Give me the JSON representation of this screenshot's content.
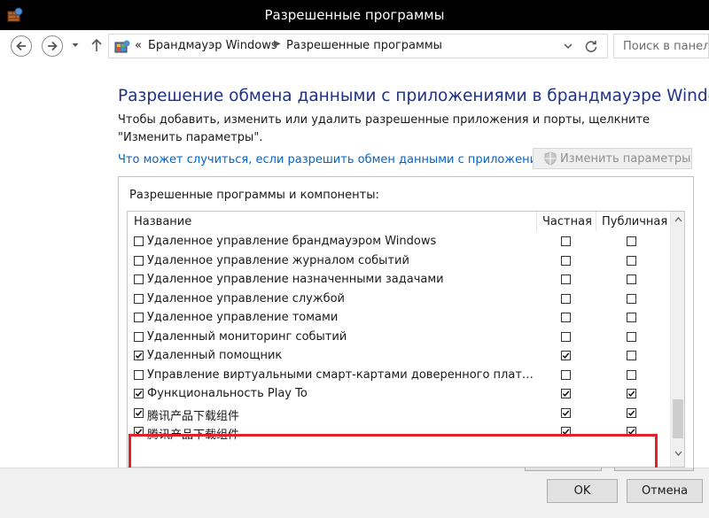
{
  "window": {
    "title": "Разрешенные программы",
    "icon": "firewall-app-icon"
  },
  "navigation": {
    "breadcrumb_prefix": "«",
    "breadcrumb": [
      "Брандмауэр Windows",
      "Разрешенные программы"
    ],
    "search_placeholder": "Поиск в панели"
  },
  "page": {
    "heading": "Разрешение обмена данными с приложениями в брандмауэре Windows",
    "description": "Чтобы добавить, изменить или удалить разрешенные приложения и порты, щелкните \"Изменить параметры\".",
    "risk_link": "Что может случиться, если разрешить обмен данными с приложением?",
    "change_settings_label": "Изменить параметры"
  },
  "panel": {
    "title": "Разрешенные программы и компоненты:",
    "columns": {
      "name": "Название",
      "private": "Частная",
      "public": "Публичная"
    },
    "rows": [
      {
        "name": "Удаленное управление брандмауэром Windows",
        "enabled": false,
        "private": false,
        "public": false
      },
      {
        "name": "Удаленное управление журналом событий",
        "enabled": false,
        "private": false,
        "public": false
      },
      {
        "name": "Удаленное управление назначенными задачами",
        "enabled": false,
        "private": false,
        "public": false
      },
      {
        "name": "Удаленное управление службой",
        "enabled": false,
        "private": false,
        "public": false
      },
      {
        "name": "Удаленное управление томами",
        "enabled": false,
        "private": false,
        "public": false
      },
      {
        "name": "Удаленный мониторинг событий",
        "enabled": false,
        "private": false,
        "public": false
      },
      {
        "name": "Удаленный помощник",
        "enabled": true,
        "private": true,
        "public": false
      },
      {
        "name": "Управление виртуальными смарт-картами доверенного платформ...",
        "enabled": false,
        "private": false,
        "public": false
      },
      {
        "name": "Функциональность Play To",
        "enabled": true,
        "private": true,
        "public": true
      },
      {
        "name": "腾讯产品下载组件",
        "enabled": true,
        "private": true,
        "public": true,
        "highlighted": true
      },
      {
        "name": "腾讯产品下载组件",
        "enabled": true,
        "private": true,
        "public": true,
        "highlighted": true
      }
    ]
  },
  "buttons": {
    "ok": "OK",
    "cancel": "Отмена"
  },
  "colors": {
    "heading": "#1e3287",
    "link": "#0066cc",
    "highlight_border": "#e0202a",
    "titlebar": "#000000"
  }
}
